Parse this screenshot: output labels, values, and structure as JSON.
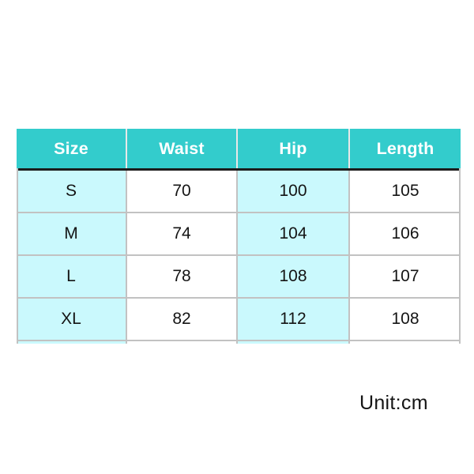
{
  "table": {
    "columns": [
      "Size",
      "Waist",
      "Hip",
      "Length"
    ],
    "rows": [
      {
        "size": "S",
        "waist": "70",
        "hip": "100",
        "length": "105"
      },
      {
        "size": "M",
        "waist": "74",
        "hip": "104",
        "length": "106"
      },
      {
        "size": "L",
        "waist": "78",
        "hip": "108",
        "length": "107"
      },
      {
        "size": "XL",
        "waist": "82",
        "hip": "112",
        "length": "108"
      }
    ]
  },
  "unit_note": "Unit:cm",
  "colors": {
    "header_bg": "#33cccc",
    "header_text": "#ffffff",
    "cell_tint": "#caf9fd",
    "cell_bg": "#ffffff",
    "grid_line": "#c2c2c2",
    "header_underline": "#1c1c1c",
    "body_text": "#141414",
    "page_bg": "#ffffff"
  },
  "chart_data": {
    "type": "table",
    "title": "",
    "columns": [
      "Size",
      "Waist",
      "Hip",
      "Length"
    ],
    "rows": [
      [
        "S",
        70,
        100,
        105
      ],
      [
        "M",
        74,
        104,
        106
      ],
      [
        "L",
        78,
        108,
        107
      ],
      [
        "XL",
        82,
        112,
        108
      ]
    ],
    "units": "cm",
    "annotations": [
      "Unit:cm"
    ]
  }
}
